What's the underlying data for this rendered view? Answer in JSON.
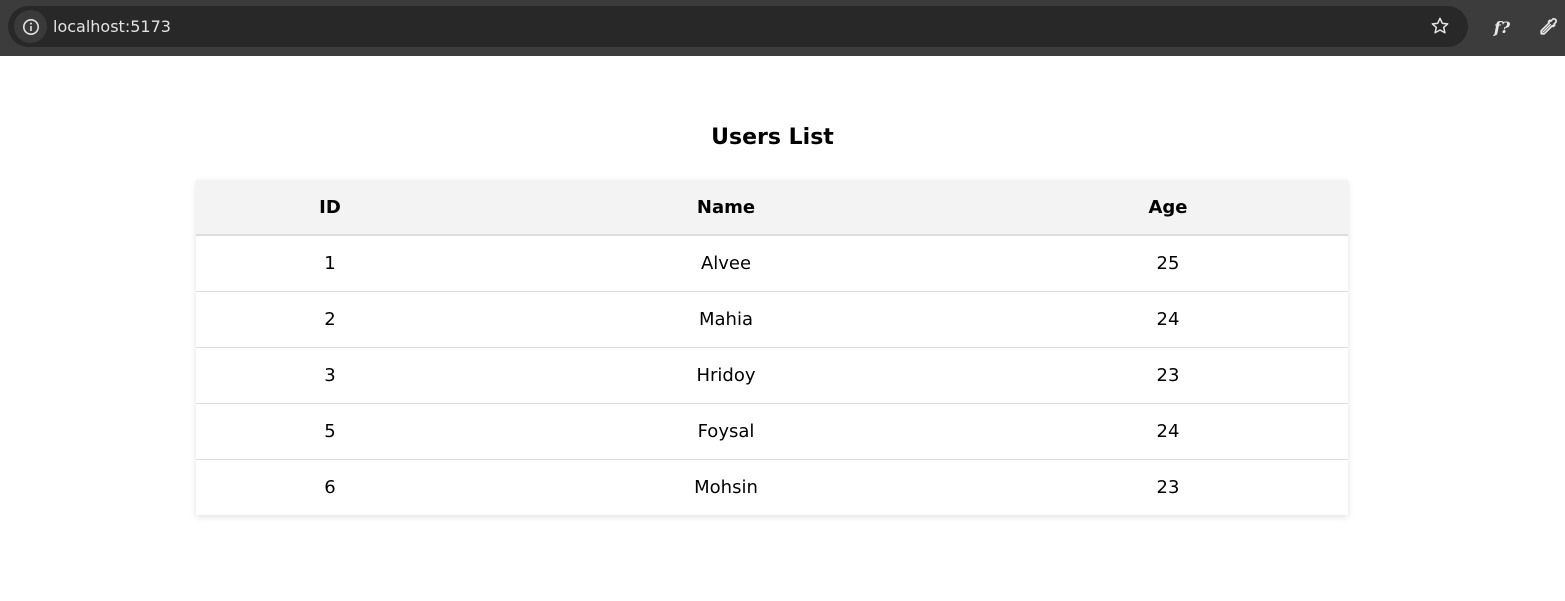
{
  "browser": {
    "url": "localhost:5173",
    "icons": {
      "site_info": "info-icon",
      "bookmark": "star-icon",
      "extension_font": "font-finder-icon",
      "extension_picker": "color-picker-icon"
    },
    "extension_font_label": "f?"
  },
  "page": {
    "title": "Users List"
  },
  "table": {
    "columns": [
      "ID",
      "Name",
      "Age"
    ],
    "rows": [
      {
        "id": "1",
        "name": "Alvee",
        "age": "25"
      },
      {
        "id": "2",
        "name": "Mahia",
        "age": "24"
      },
      {
        "id": "3",
        "name": "Hridoy",
        "age": "23"
      },
      {
        "id": "5",
        "name": "Foysal",
        "age": "24"
      },
      {
        "id": "6",
        "name": "Mohsin",
        "age": "23"
      }
    ]
  },
  "colors": {
    "chrome_bg": "#3c3c3c",
    "omnibox_bg": "#282828",
    "header_row_bg": "#f3f3f3",
    "row_divider": "#dddddd"
  }
}
